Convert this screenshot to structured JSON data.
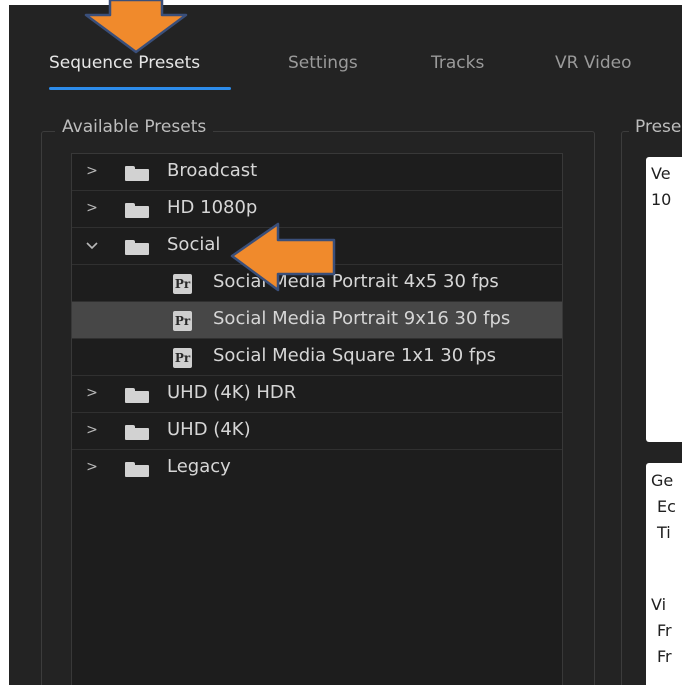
{
  "tabs": [
    {
      "label": "Sequence Presets",
      "active": true
    },
    {
      "label": "Settings",
      "active": false
    },
    {
      "label": "Tracks",
      "active": false
    },
    {
      "label": "VR Video",
      "active": false
    }
  ],
  "presets_group": {
    "title": "Available Presets"
  },
  "preview_group": {
    "title": "Prese"
  },
  "tree": [
    {
      "type": "folder",
      "label": "Broadcast",
      "expanded": false
    },
    {
      "type": "folder",
      "label": "HD 1080p",
      "expanded": false
    },
    {
      "type": "folder",
      "label": "Social",
      "expanded": true
    },
    {
      "type": "preset",
      "label": "Social Media Portrait 4x5 30 fps",
      "icon": "Pr"
    },
    {
      "type": "preset",
      "label": "Social Media Portrait 9x16 30 fps",
      "icon": "Pr",
      "selected": true
    },
    {
      "type": "preset",
      "label": "Social Media Square 1x1 30 fps",
      "icon": "Pr"
    },
    {
      "type": "folder",
      "label": "UHD (4K) HDR",
      "expanded": false
    },
    {
      "type": "folder",
      "label": "UHD (4K)",
      "expanded": false
    },
    {
      "type": "folder",
      "label": "Legacy",
      "expanded": false
    }
  ],
  "description_panel": {
    "lines": [
      "Ve",
      "10"
    ]
  },
  "general_panel": {
    "lines": [
      "Ge",
      "Ec",
      "Ti",
      "",
      "Vi",
      "Fr",
      "Fr"
    ]
  },
  "colors": {
    "accent": "#2d8ceb",
    "arrow": "#f08a2c",
    "arrow_border": "#3a4f7a",
    "selected_row": "#474747"
  },
  "icons": {
    "collapsed": "chevron-right-icon",
    "expanded": "chevron-down-icon",
    "folder": "folder-icon",
    "preset": "premiere-preset-icon",
    "annotation": "orange-arrow-icon"
  }
}
